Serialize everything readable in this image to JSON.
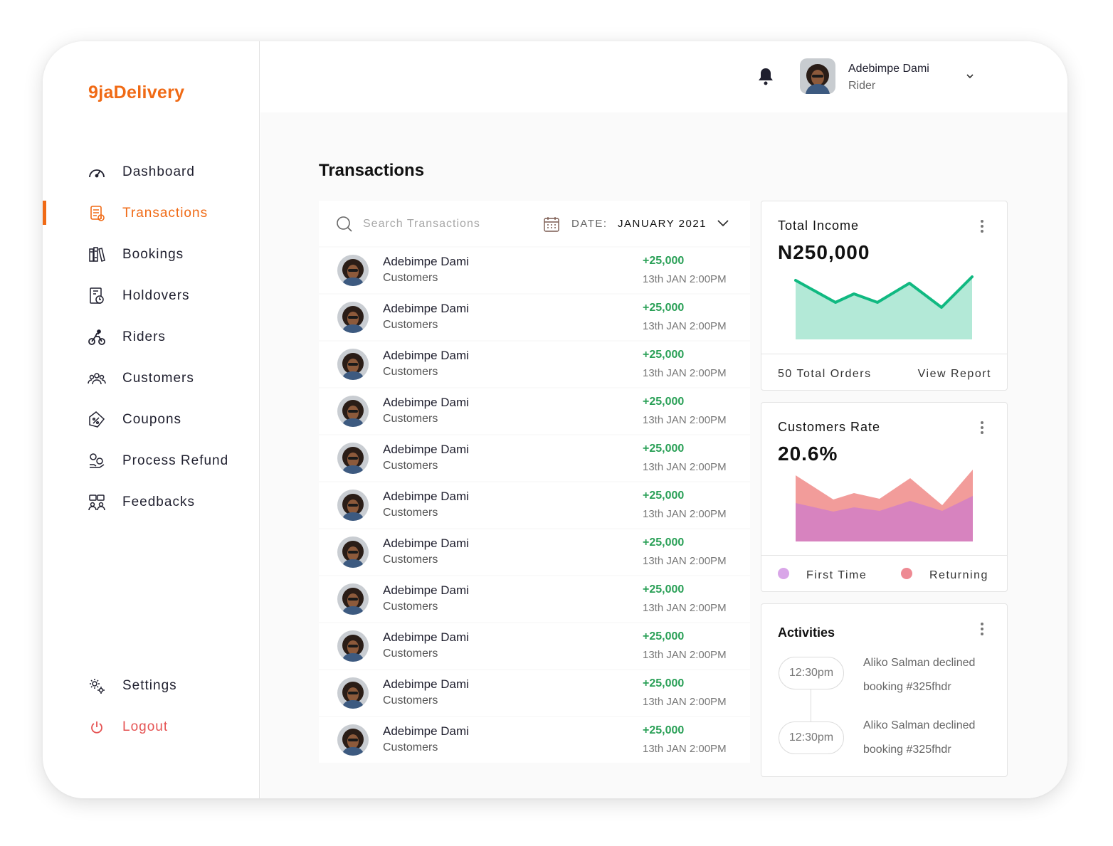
{
  "app": {
    "logo": "9jaDelivery"
  },
  "sidebar": {
    "items": [
      {
        "label": "Dashboard",
        "icon": "speedometer-icon"
      },
      {
        "label": "Transactions",
        "icon": "transactions-icon",
        "active": true
      },
      {
        "label": "Bookings",
        "icon": "bookings-icon"
      },
      {
        "label": "Holdovers",
        "icon": "holdovers-icon"
      },
      {
        "label": "Riders",
        "icon": "rider-icon"
      },
      {
        "label": "Customers",
        "icon": "customers-icon"
      },
      {
        "label": "Coupons",
        "icon": "coupon-icon"
      },
      {
        "label": "Process Refund",
        "icon": "refund-icon"
      },
      {
        "label": "Feedbacks",
        "icon": "feedback-icon"
      }
    ],
    "bottom": [
      {
        "label": "Settings",
        "icon": "gear-icon"
      },
      {
        "label": "Logout",
        "icon": "power-icon"
      }
    ]
  },
  "header": {
    "user_name": "Adebimpe Dami",
    "user_role": "Rider",
    "notification_icon": "bell-icon"
  },
  "page": {
    "title": "Transactions"
  },
  "transactions": {
    "search_placeholder": "Search Transactions",
    "date_label": "DATE:",
    "date_value": "JANUARY 2021",
    "rows": [
      {
        "name": "Adebimpe Dami",
        "type": "Customers",
        "amount": "+25,000",
        "time": "13th JAN 2:00PM"
      },
      {
        "name": "Adebimpe Dami",
        "type": "Customers",
        "amount": "+25,000",
        "time": "13th JAN 2:00PM"
      },
      {
        "name": "Adebimpe Dami",
        "type": "Customers",
        "amount": "+25,000",
        "time": "13th JAN 2:00PM"
      },
      {
        "name": "Adebimpe Dami",
        "type": "Customers",
        "amount": "+25,000",
        "time": "13th JAN 2:00PM"
      },
      {
        "name": "Adebimpe Dami",
        "type": "Customers",
        "amount": "+25,000",
        "time": "13th JAN 2:00PM"
      },
      {
        "name": "Adebimpe Dami",
        "type": "Customers",
        "amount": "+25,000",
        "time": "13th JAN 2:00PM"
      },
      {
        "name": "Adebimpe Dami",
        "type": "Customers",
        "amount": "+25,000",
        "time": "13th JAN 2:00PM"
      },
      {
        "name": "Adebimpe Dami",
        "type": "Customers",
        "amount": "+25,000",
        "time": "13th JAN 2:00PM"
      },
      {
        "name": "Adebimpe Dami",
        "type": "Customers",
        "amount": "+25,000",
        "time": "13th JAN 2:00PM"
      },
      {
        "name": "Adebimpe Dami",
        "type": "Customers",
        "amount": "+25,000",
        "time": "13th JAN 2:00PM"
      },
      {
        "name": "Adebimpe Dami",
        "type": "Customers",
        "amount": "+25,000",
        "time": "13th JAN 2:00PM"
      }
    ]
  },
  "income_card": {
    "title": "Total Income",
    "value": "N250,000",
    "footer_left": "50 Total Orders",
    "footer_right": "View Report"
  },
  "rate_card": {
    "title": "Customers Rate",
    "value": "20.6%",
    "legend": [
      {
        "label": "First Time",
        "color": "#d9a6e8"
      },
      {
        "label": "Returning",
        "color": "#ee8a93"
      }
    ]
  },
  "activities": {
    "title": "Activities",
    "items": [
      {
        "time": "12:30pm",
        "line1": "Aliko Salman declined",
        "line2": "booking #325fhdr"
      },
      {
        "time": "12:30pm",
        "line1": "Aliko Salman declined",
        "line2": "booking #325fhdr"
      }
    ]
  },
  "colors": {
    "accent": "#f06a15",
    "positive": "#2aa057",
    "logout": "#e55353",
    "income_line": "#10b981",
    "income_fill": "#b3e9d7",
    "returning_fill": "#f29c9a",
    "first_time_fill": "#d783bf"
  }
}
